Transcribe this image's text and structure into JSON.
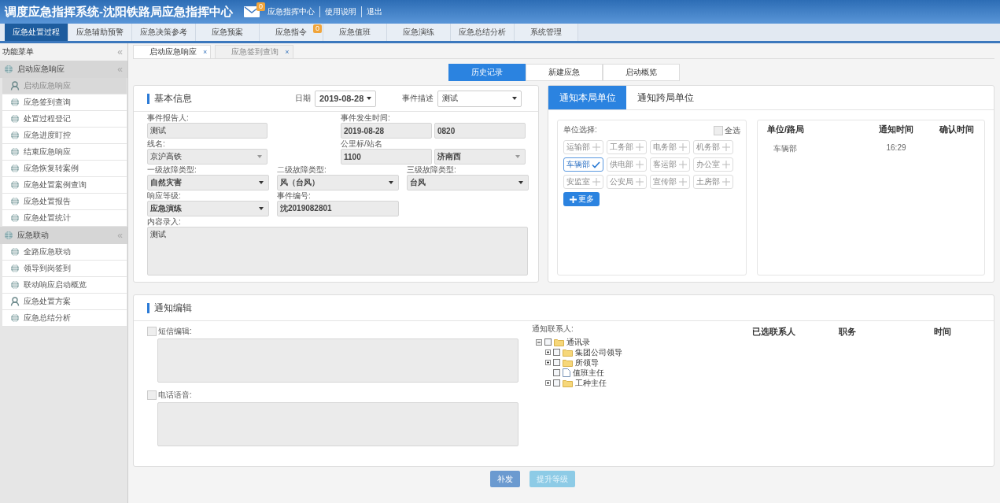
{
  "header": {
    "title": "调度应急指挥系统-沈阳铁路局应急指挥中心",
    "mail_badge": "0",
    "links": [
      "应急指挥中心",
      "使用说明",
      "退出"
    ]
  },
  "nav": [
    {
      "label": "应急处置过程",
      "selected": true
    },
    {
      "label": "应急辅助预警",
      "selected": false
    },
    {
      "label": "应急决策参考",
      "selected": false
    },
    {
      "label": "应急预案",
      "selected": false
    },
    {
      "label": "应急指令",
      "selected": false,
      "badge": "0"
    },
    {
      "label": "应急值班",
      "selected": false
    },
    {
      "label": "应急演练",
      "selected": false
    },
    {
      "label": "应急总结分析",
      "selected": false
    },
    {
      "label": "系统管理",
      "selected": false
    }
  ],
  "sidebar": {
    "title": "功能菜单",
    "collapse": "«",
    "groups": [
      {
        "label": "启动应急响应",
        "collapse": "«",
        "items": [
          {
            "label": "启动应急响应",
            "kind": "person",
            "selected": true
          },
          {
            "label": "应急签到查询",
            "kind": "globe",
            "selected": false
          },
          {
            "label": "处置过程登记",
            "kind": "globe",
            "selected": false
          },
          {
            "label": "应急进度盯控",
            "kind": "globe",
            "selected": false
          },
          {
            "label": "结束应急响应",
            "kind": "globe",
            "selected": false
          },
          {
            "label": "应急恢复转案例",
            "kind": "globe",
            "selected": false
          },
          {
            "label": "应急处置案例查询",
            "kind": "globe",
            "selected": false
          },
          {
            "label": "应急处置报告",
            "kind": "globe",
            "selected": false
          },
          {
            "label": "应急处置统计",
            "kind": "globe",
            "selected": false
          }
        ]
      },
      {
        "label": "应急联动",
        "collapse": "«",
        "items": [
          {
            "label": "全路应急联动",
            "kind": "globe",
            "selected": false
          },
          {
            "label": "领导到岗签到",
            "kind": "globe",
            "selected": false
          },
          {
            "label": "联动响应启动概览",
            "kind": "globe",
            "selected": false
          },
          {
            "label": "应急处置方案",
            "kind": "person",
            "selected": false
          },
          {
            "label": "应急总结分析",
            "kind": "globe",
            "selected": false
          }
        ]
      }
    ]
  },
  "page_tabs": [
    {
      "label": "启动应急响应",
      "close": "×",
      "selected": true
    },
    {
      "label": "应急签到查询",
      "close": "×",
      "selected": false
    }
  ],
  "segments": [
    {
      "label": "历史记录",
      "selected": true
    },
    {
      "label": "新建应急",
      "selected": false
    },
    {
      "label": "启动概览",
      "selected": false
    }
  ],
  "basic_info": {
    "title": "基本信息",
    "date_label": "日期",
    "date": "2019-08-28",
    "desc_label": "事件描述",
    "desc": "测试",
    "rows": [
      {
        "kind": "pair",
        "fields": [
          {
            "label": "事件报告人:",
            "kind": "input",
            "value": "测试"
          },
          {
            "label": "事件发生时间:",
            "kind": "input_pair",
            "values": [
              "2019-08-28",
              "0820"
            ]
          }
        ]
      },
      {
        "kind": "pair",
        "fields": [
          {
            "label": "线名:",
            "kind": "combo",
            "value": "京沪高铁"
          },
          {
            "label": "公里标/站名",
            "kind": "input_combo",
            "values": [
              "1100",
              "济南西"
            ]
          }
        ]
      },
      {
        "kind": "triple",
        "fields": [
          {
            "label": "一级故障类型:",
            "kind": "select",
            "value": "自然灾害"
          },
          {
            "label": "二级故障类型:",
            "kind": "select",
            "value": "风（台风）"
          },
          {
            "label": "三级故障类型:",
            "kind": "select",
            "value": "台风"
          }
        ]
      },
      {
        "kind": "triple",
        "fields": [
          {
            "label": "响应等级:",
            "kind": "select",
            "value": "应急演练"
          },
          {
            "label": "事件编号:",
            "kind": "input",
            "value": "沈2019082801"
          }
        ]
      }
    ],
    "content_label": "内容录入:",
    "content": "测试"
  },
  "notify": {
    "tabs": [
      {
        "label": "通知本局单位",
        "selected": true
      },
      {
        "label": "通知跨局单位",
        "selected": false
      }
    ],
    "unit_label": "单位选择:",
    "select_all": {
      "label": "全选",
      "checked": false
    },
    "units": [
      {
        "label": "运输部",
        "selected": false
      },
      {
        "label": "工务部",
        "selected": false
      },
      {
        "label": "电务部",
        "selected": false
      },
      {
        "label": "机务部",
        "selected": false
      },
      {
        "label": "车辆部",
        "selected": true
      },
      {
        "label": "供电部",
        "selected": false
      },
      {
        "label": "客运部",
        "selected": false
      },
      {
        "label": "办公室",
        "selected": false
      },
      {
        "label": "安监室",
        "selected": false
      },
      {
        "label": "公安局",
        "selected": false
      },
      {
        "label": "宣传部",
        "selected": false
      },
      {
        "label": "土房部",
        "selected": false
      }
    ],
    "more": "更多",
    "columns": [
      "单位/路局",
      "通知时间",
      "确认时间"
    ],
    "rows": [
      {
        "unit": "车辆部",
        "notify_time": "16:29"
      }
    ]
  },
  "edit": {
    "title": "通知编辑",
    "sms": {
      "label": "短信编辑:",
      "checked": false
    },
    "phone": {
      "label": "电话语音:",
      "checked": false
    },
    "contacts_label": "通知联系人:",
    "tree": [
      {
        "label": "通讯录",
        "kind": "folder",
        "expanded": true,
        "checked": false,
        "children": [
          {
            "label": "集团公司领导",
            "kind": "folder",
            "expanded": false,
            "checked": false
          },
          {
            "label": "所领导",
            "kind": "folder",
            "expanded": false,
            "checked": false
          },
          {
            "label": "值班主任",
            "kind": "file",
            "checked": false
          },
          {
            "label": "工种主任",
            "kind": "folder",
            "expanded": false,
            "checked": false
          }
        ]
      }
    ],
    "columns": [
      "已选联系人",
      "职务",
      "时间"
    ]
  },
  "actions": [
    {
      "label": "补发",
      "disabled": false
    },
    {
      "label": "提升等级",
      "disabled": true
    }
  ]
}
